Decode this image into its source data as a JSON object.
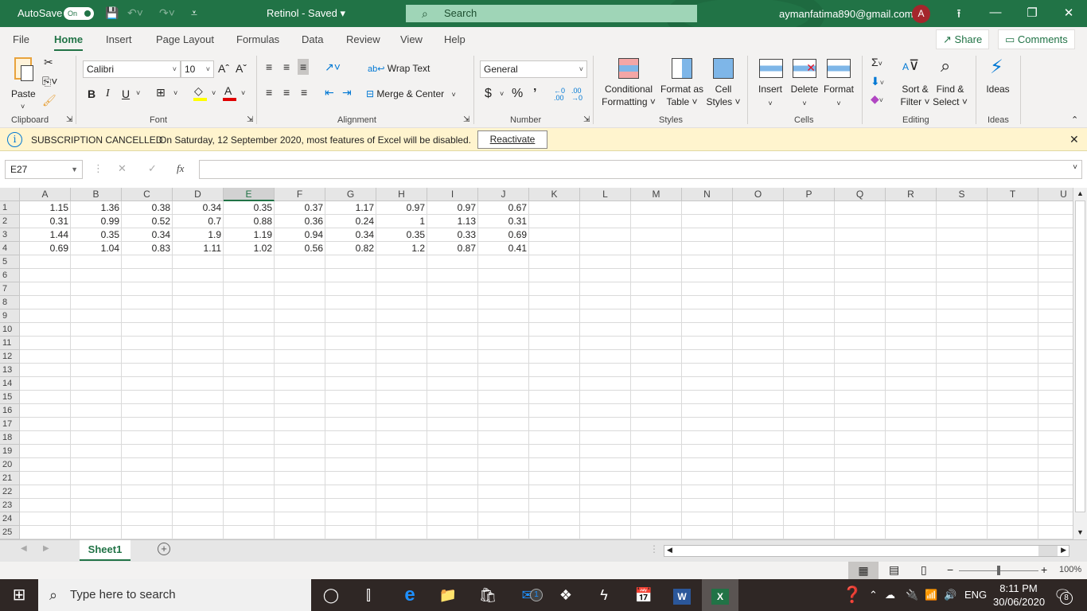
{
  "titlebar": {
    "autosave_label": "AutoSave",
    "autosave_state": "On",
    "doc_title": "Retinol  -  Saved",
    "search_placeholder": "Search",
    "account_email": "aymanfatima890@gmail.com",
    "avatar_initial": "A"
  },
  "menu": {
    "tabs": [
      "File",
      "Home",
      "Insert",
      "Page Layout",
      "Formulas",
      "Data",
      "Review",
      "View",
      "Help"
    ],
    "active_tab": "Home",
    "share_label": "Share",
    "comments_label": "Comments"
  },
  "ribbon": {
    "clipboard": {
      "paste": "Paste",
      "label": "Clipboard"
    },
    "font": {
      "name": "Calibri",
      "size": "10",
      "label": "Font",
      "bold": "B",
      "italic": "I",
      "underline": "U",
      "highlight_color": "#ffff00",
      "font_color": "#e00000"
    },
    "alignment": {
      "wrap_text": "Wrap Text",
      "merge_center": "Merge & Center",
      "label": "Alignment"
    },
    "number": {
      "format": "General",
      "label": "Number",
      "currency": "$",
      "percent": "%",
      "comma": "❩"
    },
    "styles": {
      "conditional_1": "Conditional",
      "conditional_2": "Formatting ˅",
      "format_table_1": "Format as",
      "format_table_2": "Table ˅",
      "cell_styles_1": "Cell",
      "cell_styles_2": "Styles ˅",
      "label": "Styles"
    },
    "cells": {
      "insert": "Insert",
      "delete": "Delete",
      "format": "Format",
      "label": "Cells"
    },
    "editing": {
      "sort_1": "Sort &",
      "sort_2": "Filter ˅",
      "find_1": "Find &",
      "find_2": "Select ˅",
      "label": "Editing"
    },
    "ideas": {
      "button": "Ideas",
      "label": "Ideas"
    }
  },
  "infobar": {
    "title": "SUBSCRIPTION CANCELLED",
    "message": "On Saturday, 12 September 2020, most features of Excel will be disabled.",
    "button": "Reactivate"
  },
  "formula_bar": {
    "name_box": "E27",
    "formula": "",
    "fx": "fx"
  },
  "grid": {
    "columns": [
      "A",
      "B",
      "C",
      "D",
      "E",
      "F",
      "G",
      "H",
      "I",
      "J",
      "K",
      "L",
      "M",
      "N",
      "O",
      "P",
      "Q",
      "R",
      "S",
      "T",
      "U"
    ],
    "selected_column": "E",
    "row_count": 25,
    "rows": [
      [
        "1.15",
        "1.36",
        "0.38",
        "0.34",
        "0.35",
        "0.37",
        "1.17",
        "0.97",
        "0.97",
        "0.67"
      ],
      [
        "0.31",
        "0.99",
        "0.52",
        "0.7",
        "0.88",
        "0.36",
        "0.24",
        "1",
        "1.13",
        "0.31"
      ],
      [
        "1.44",
        "0.35",
        "0.34",
        "1.9",
        "1.19",
        "0.94",
        "0.34",
        "0.35",
        "0.33",
        "0.69"
      ],
      [
        "0.69",
        "1.04",
        "0.83",
        "1.11",
        "1.02",
        "0.56",
        "0.82",
        "1.2",
        "0.87",
        "0.41"
      ]
    ]
  },
  "sheets": {
    "tabs": [
      "Sheet1"
    ],
    "active": "Sheet1"
  },
  "statusbar": {
    "zoom": "100%",
    "zoom_value": 100
  },
  "taskbar": {
    "search_placeholder": "Type here to search",
    "mail_badge": "1",
    "language": "ENG",
    "time": "8:11 PM",
    "date": "30/06/2020",
    "notification_count": "8"
  }
}
